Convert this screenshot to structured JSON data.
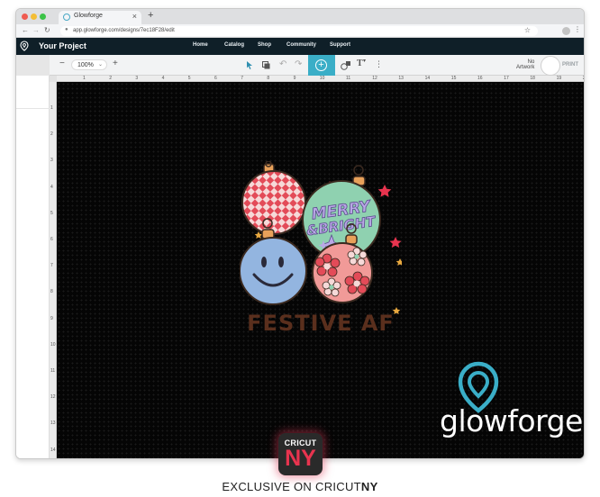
{
  "browser": {
    "tab_title": "Glowforge",
    "url": "app.glowforge.com/designs/7ec18F28/edit"
  },
  "app": {
    "project_title": "Your Project",
    "nav": [
      "Home",
      "Catalog",
      "Shop",
      "Community",
      "Support"
    ]
  },
  "toolbar": {
    "zoom": "100%",
    "no_artwork_line1": "No",
    "no_artwork_line2": "Artwork",
    "print_label": "PRINT"
  },
  "rulers": {
    "top": [
      "1",
      "2",
      "3",
      "4",
      "5",
      "6",
      "7",
      "8",
      "9",
      "10",
      "11",
      "12",
      "13",
      "14",
      "15",
      "16",
      "17",
      "18",
      "19",
      "20"
    ],
    "left": [
      "1",
      "2",
      "3",
      "4",
      "5",
      "6",
      "7",
      "8",
      "9",
      "10",
      "11",
      "12",
      "13",
      "14"
    ]
  },
  "artwork": {
    "ornament_text_1": "MERRY",
    "ornament_text_2": "&BRIGHT",
    "caption": "FESTIVE AF"
  },
  "watermark": {
    "brand": "glowforge"
  },
  "badge": {
    "top": "CRICUT",
    "bottom": "NY",
    "exclusive_prefix": "EXCLUSIVE ON CRICUT",
    "exclusive_suffix": "NY"
  },
  "colors": {
    "nav_bg": "#0f1f28",
    "accent": "#3aaec7",
    "canvas_bg": "#050505",
    "badge_red": "#e8344f"
  }
}
